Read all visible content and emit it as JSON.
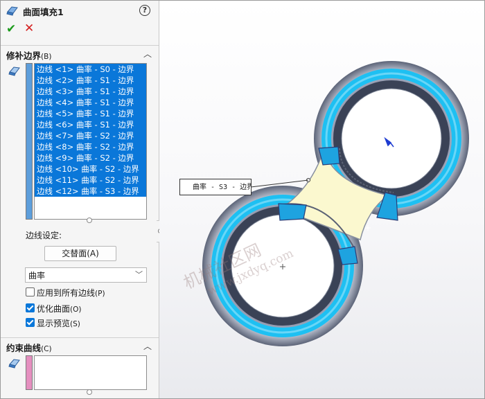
{
  "feature": {
    "title": "曲面填充1",
    "help_label": "?",
    "ok_label": "✔",
    "cancel_label": "✕"
  },
  "patch_boundary": {
    "title": "修补边界",
    "shortcut": "(B)",
    "edges": [
      "边线 <1> 曲率 - S0 - 边界",
      "边线 <2> 曲率 - S1 - 边界",
      "边线 <3> 曲率 - S1 - 边界",
      "边线 <4> 曲率 - S1 - 边界",
      "边线 <5> 曲率 - S1 - 边界",
      "边线 <6> 曲率 - S1 - 边界",
      "边线 <7> 曲率 - S2 - 边界",
      "边线 <8> 曲率 - S2 - 边界",
      "边线 <9> 曲率 - S2 - 边界",
      "边线 <10> 曲率 - S2 - 边界",
      "边线 <11> 曲率 - S2 - 边界",
      "边线 <12> 曲率 - S3 - 边界"
    ],
    "edge_settings_label": "边线设定:",
    "alternate_face_button": "交替面",
    "alternate_face_shortcut": "(A)",
    "condition_value": "曲率",
    "apply_all_label": "应用到所有边线",
    "apply_all_shortcut": "(P)",
    "apply_all_checked": false,
    "optimize_label": "优化曲面",
    "optimize_shortcut": "(O)",
    "optimize_checked": true,
    "preview_label": "显示预览",
    "preview_shortcut": "(S)",
    "preview_checked": true
  },
  "constraint_curves": {
    "title": "约束曲线",
    "shortcut": "(C)"
  },
  "viewport": {
    "callout_text": "曲率 - S3 - 边界",
    "watermark_line1": "机械社区网",
    "watermark_line2": "www.jxdyq.com"
  },
  "colors": {
    "selection_blue": "#0a77d9",
    "ok_green": "#1b9b1b",
    "cancel_red": "#d42020",
    "boundary_stripe": "#5d9edb",
    "curve_stripe": "#e58fbf",
    "fill_preview": "#fbf8cf",
    "torus_blue": "#1ec0f2"
  }
}
